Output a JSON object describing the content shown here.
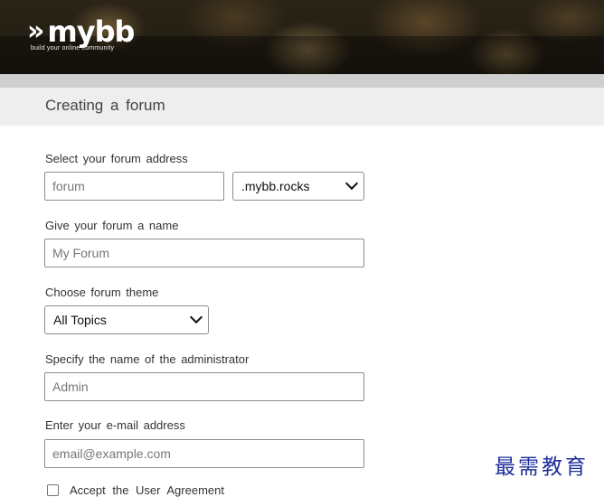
{
  "header": {
    "logo_mark": "mybb",
    "logo_chevrons": "»",
    "logo_tagline": "build your online community"
  },
  "page": {
    "title": "Creating a forum"
  },
  "form": {
    "address_label": "Select your forum address",
    "address_placeholder": "forum",
    "domain_selected": ".mybb.rocks",
    "name_label": "Give your forum a name",
    "name_placeholder": "My Forum",
    "theme_label": "Choose forum theme",
    "theme_selected": "All Topics",
    "admin_label": "Specify the name of the administrator",
    "admin_placeholder": "Admin",
    "email_label": "Enter your e-mail address",
    "email_placeholder": "email@example.com",
    "agreement_label": "Accept the User Agreement"
  },
  "watermark": "最需教育"
}
